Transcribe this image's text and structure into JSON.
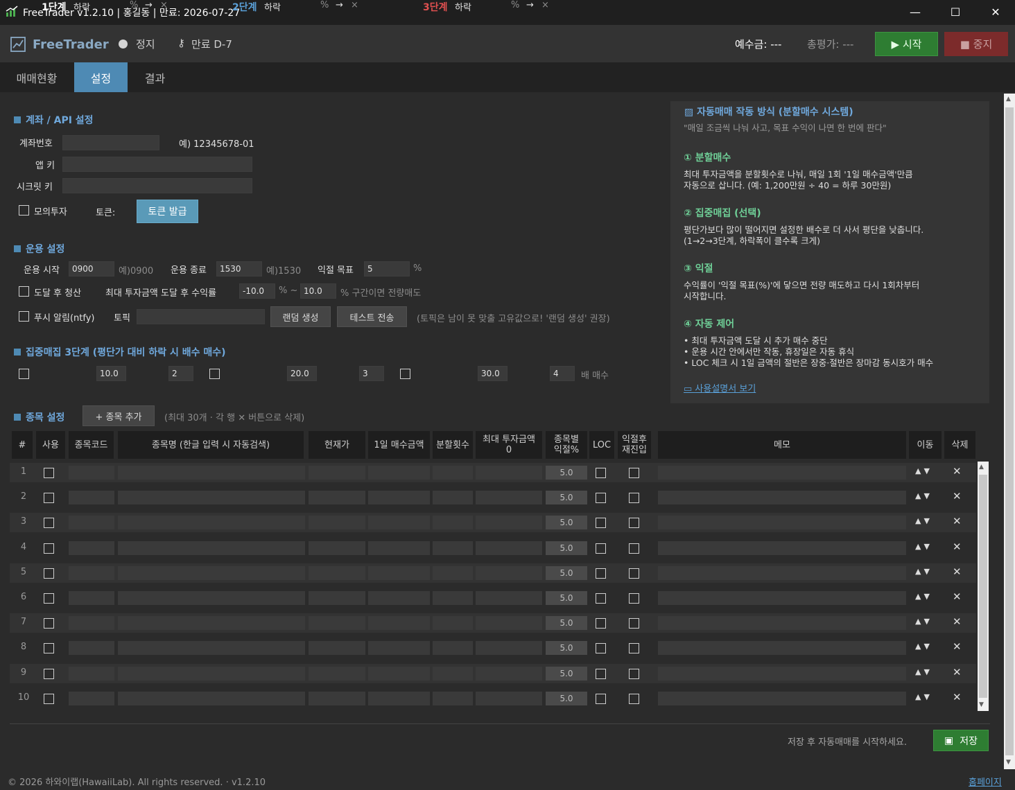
{
  "window": {
    "title": "FreeTrader v1.2.10  |  홍길동  |  만료: 2026-07-27",
    "min": "—",
    "max": "☐",
    "close": "✕"
  },
  "header": {
    "logo": "FreeTrader",
    "status": "정지",
    "expiry": "만료 D-7",
    "deposit": "예수금: ---",
    "total_eval": "총평가: ---",
    "start_label": "▶ 시작",
    "stop_label": "■ 중지"
  },
  "tabs": [
    "매매현황",
    "설정",
    "결과"
  ],
  "account": {
    "title": "계좌 / API 설정",
    "acct_label": "계좌번호",
    "acct_hint": "예) 12345678-01",
    "appkey_label": "앱 키",
    "secret_label": "시크릿 키",
    "mock_label": "모의투자",
    "token_label": "토큰:",
    "token_btn": "토큰 발급"
  },
  "ops": {
    "title": "운용 설정",
    "start_label": "운용 시작",
    "start_value": "0900",
    "start_hint": "예)0900",
    "end_label": "운용 종료",
    "end_value": "1530",
    "end_hint": "예)1530",
    "target_label": "익절 목표",
    "target_value": "5",
    "pct": "%",
    "liquidate_label": "도달 후 청산",
    "range_label": "최대 투자금액 도달 후 수익률",
    "range_low": "-10.0",
    "range_mid": "% ~",
    "range_high": "10.0",
    "range_tail": "% 구간이면 전량매도",
    "push_label": "푸시 알림(ntfy)",
    "topic_label": "토픽",
    "random_btn": "랜덤 생성",
    "test_btn": "테스트 전송",
    "topic_hint": "(토픽은 남이 못 맞출 고유값으로! '랜덤 생성' 권장)"
  },
  "focus": {
    "title": "집중매집 3단계  (평단가 대비 하락 시 배수 매수)",
    "drop": "하락",
    "pct": "%",
    "arrow": "→",
    "times": "×",
    "tail": "배 매수",
    "stages": [
      {
        "name": "1단계",
        "drop": "10.0",
        "mult": "2",
        "color": "#ffffff"
      },
      {
        "name": "2단계",
        "drop": "20.0",
        "mult": "3",
        "color": "#5aa0d8"
      },
      {
        "name": "3단계",
        "drop": "30.0",
        "mult": "4",
        "color": "#e05050"
      }
    ]
  },
  "stocks": {
    "title": "종목 설정",
    "add_btn": "+ 종목 추가",
    "hint": "(최대 30개 · 각 행 ✕ 버튼으로 삭제)",
    "headers": [
      "#",
      "사용",
      "종목코드",
      "종목명 (한글 입력 시 자동검색)",
      "현재가",
      "1일 매수금액",
      "분할횟수",
      "최대 투자금액\n0",
      "종목별\n익절%",
      "LOC",
      "익절후\n재진입",
      "메모",
      "이동",
      "삭제"
    ],
    "rows": [
      "1",
      "2",
      "3",
      "4",
      "5",
      "6",
      "7",
      "8",
      "9",
      "10"
    ],
    "pct_value": "5.0",
    "move": "▲▼",
    "delete": "✕"
  },
  "info": {
    "title": "자동매매 작동 방식 (분할매수 시스템)",
    "subtitle": "\"매일 조금씩 나눠 사고, 목표 수익이 나면 한 번에 판다\"",
    "s1_title": "① 분할매수",
    "s1_l1": "최대 투자금액을 분할횟수로 나눠, 매일 1회 '1일 매수금액'만큼",
    "s1_l2": "자동으로 삽니다.  (예: 1,200만원 ÷ 40 = 하루 30만원)",
    "s2_title": "② 집중매집 (선택)",
    "s2_l1": "평단가보다 많이 떨어지면 설정한 배수로 더 사서 평단을 낮춥니다.",
    "s2_l2": "(1→2→3단계, 하락폭이 클수록 크게)",
    "s3_title": "③ 익절",
    "s3_l1": "수익률이 '익절 목표(%)'에 닿으면 전량 매도하고 다시 1회차부터",
    "s3_l2": "시작합니다.",
    "s4_title": "④ 자동 제어",
    "s4_l1": "• 최대 투자금액 도달 시 추가 매수 중단",
    "s4_l2": "• 운용 시간 안에서만 작동, 휴장일은 자동 휴식",
    "s4_l3": "• LOC 체크 시 1일 금액의 절반은 장중·절반은 장마감 동시호가 매수",
    "manual_link": "사용설명서 보기"
  },
  "footer": {
    "save_hint": "저장 후 자동매매를 시작하세요.",
    "save_btn": "저장",
    "copyright": "© 2026 하와이랩(HawaiiLab). All rights reserved.   ·   v1.2.10",
    "homepage": "홈페이지"
  },
  "colors": {
    "accent": "#4e8ab4",
    "start": "#2e7d32",
    "stop": "#7c2b2b",
    "info_heading": "#6fcf97"
  }
}
